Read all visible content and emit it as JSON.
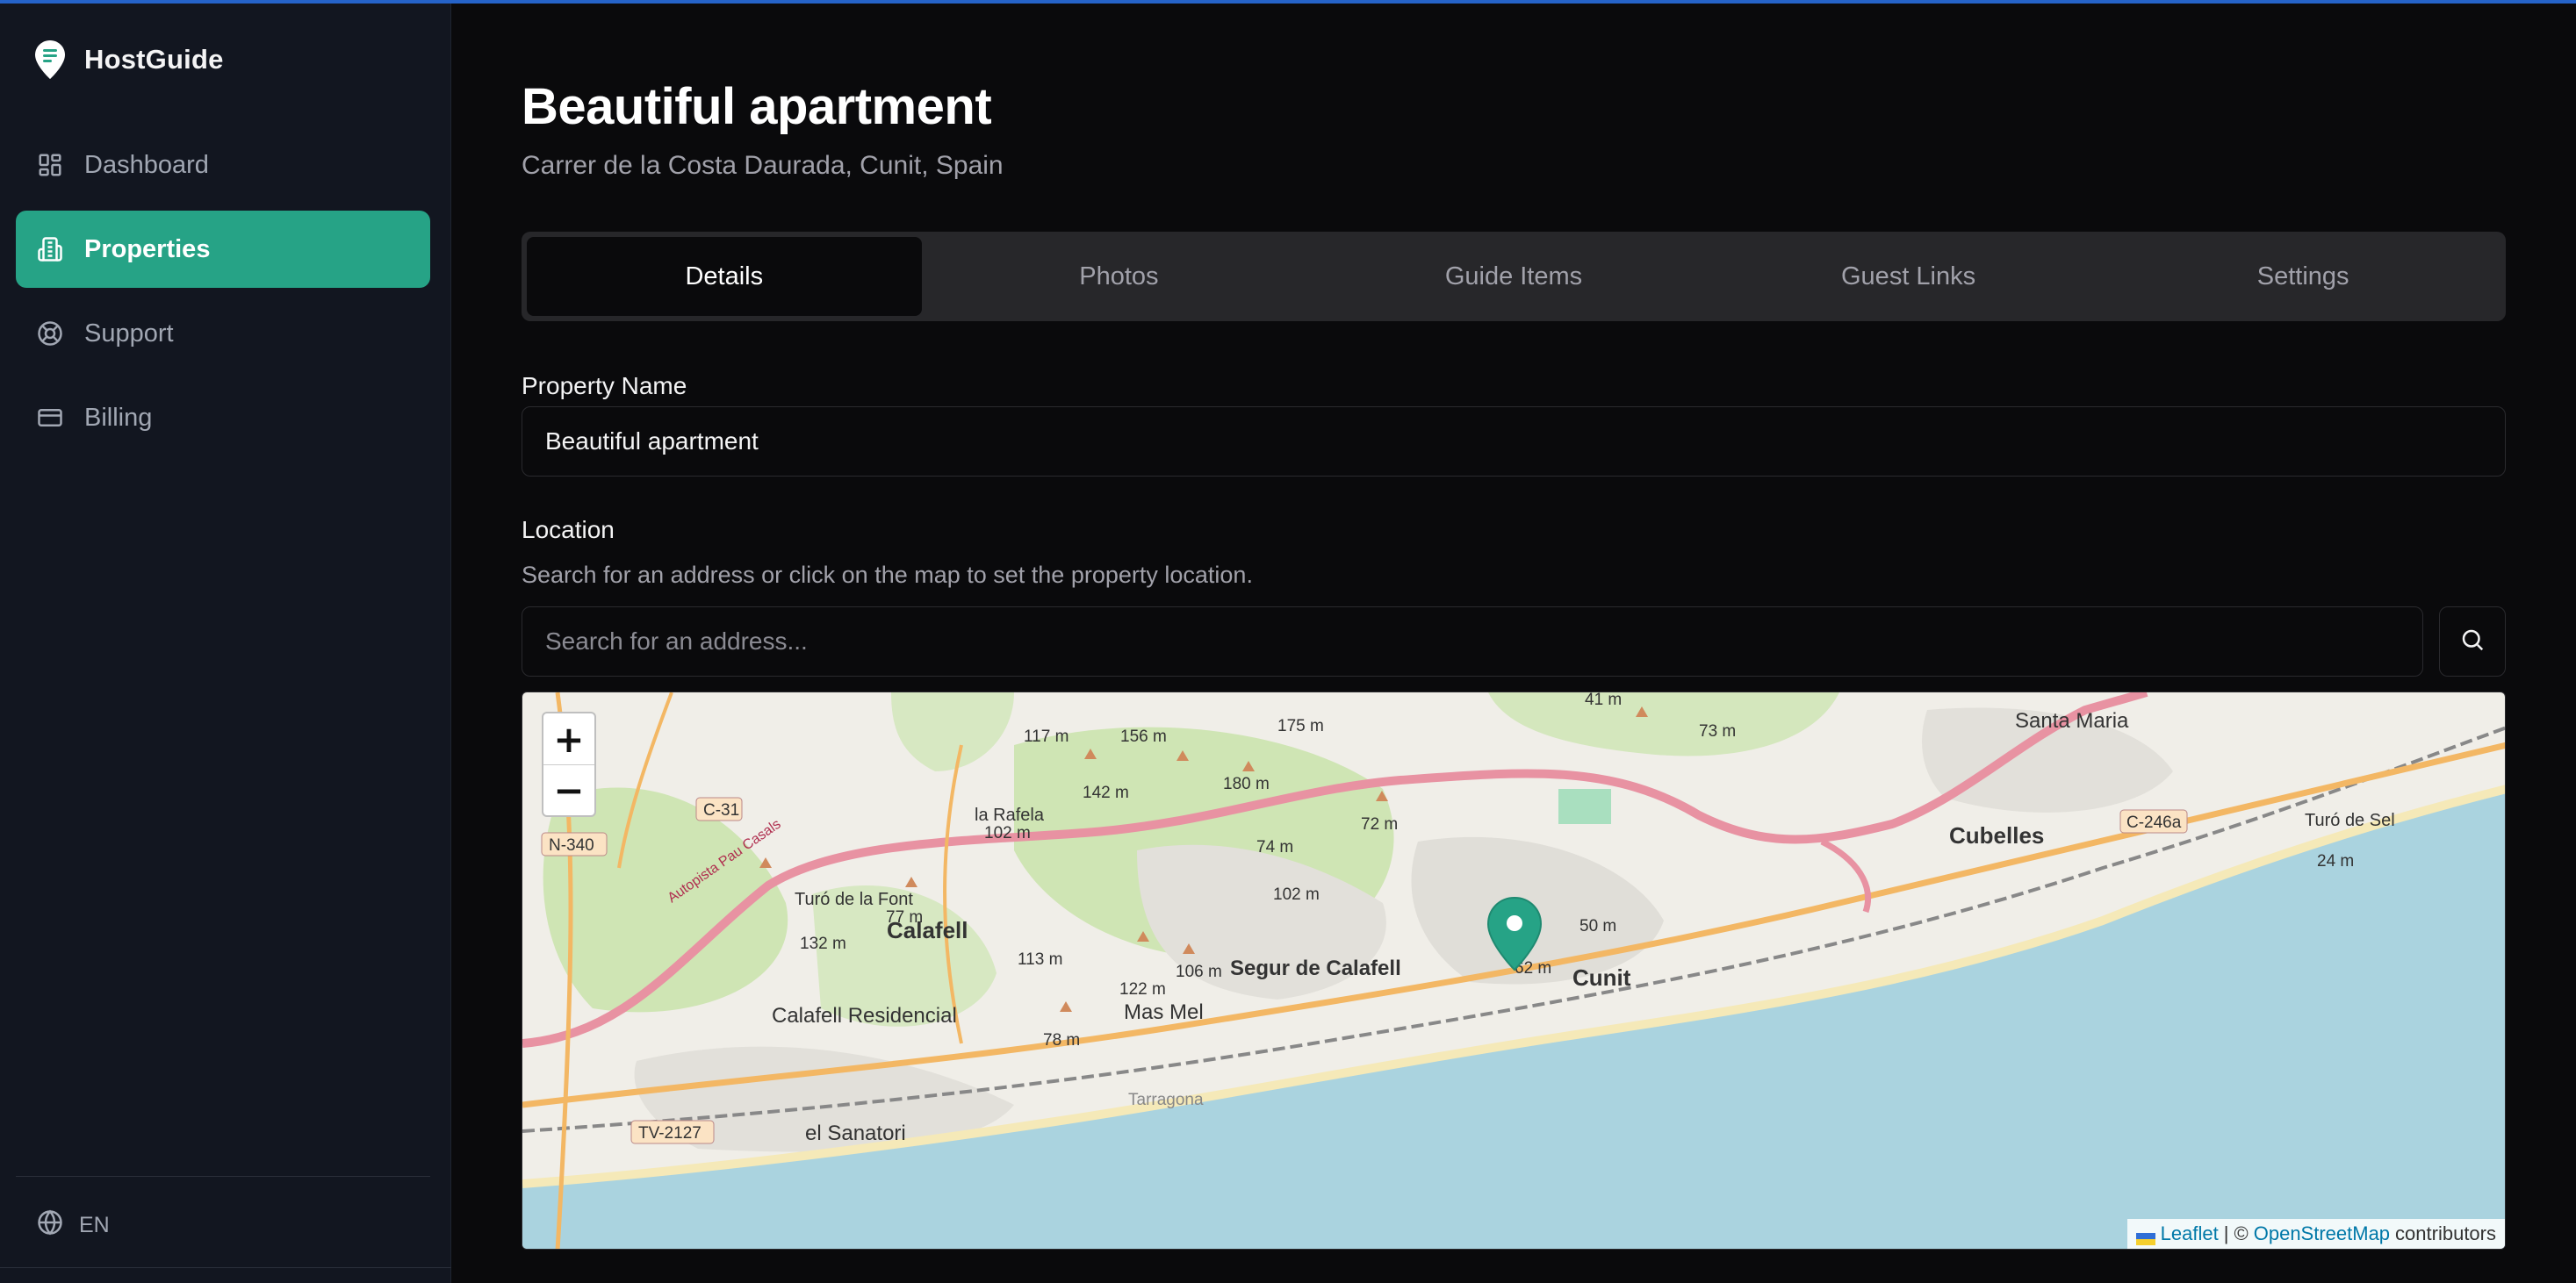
{
  "app": {
    "name": "HostGuide"
  },
  "sidebar": {
    "items": [
      {
        "label": "Dashboard",
        "icon": "dashboard-icon",
        "active": false
      },
      {
        "label": "Properties",
        "icon": "building-icon",
        "active": true
      },
      {
        "label": "Support",
        "icon": "lifebuoy-icon",
        "active": false
      },
      {
        "label": "Billing",
        "icon": "credit-card-icon",
        "active": false
      }
    ],
    "language": "EN"
  },
  "page": {
    "title": "Beautiful apartment",
    "subtitle": "Carrer de la Costa Daurada, Cunit, Spain"
  },
  "tabs": [
    {
      "label": "Details",
      "active": true
    },
    {
      "label": "Photos",
      "active": false
    },
    {
      "label": "Guide Items",
      "active": false
    },
    {
      "label": "Guest Links",
      "active": false
    },
    {
      "label": "Settings",
      "active": false
    }
  ],
  "form": {
    "property_name_label": "Property Name",
    "property_name_value": "Beautiful apartment",
    "location_label": "Location",
    "location_helper": "Search for an address or click on the map to set the property location.",
    "search_placeholder": "Search for an address..."
  },
  "map": {
    "zoom_in": "+",
    "zoom_out": "−",
    "attribution_leaflet": "Leaflet",
    "attribution_sep": "| ©",
    "attribution_osm": "OpenStreetMap",
    "attribution_suffix": "contributors",
    "labels": {
      "santa_maria": "Santa Maria",
      "cubelles": "Cubelles",
      "calafell": "Calafell",
      "segur": "Segur de Calafell",
      "cunit": "Cunit",
      "calafell_res": "Calafell Residencial",
      "mas_mel": "Mas Mel",
      "el_sanatori": "el Sanatori",
      "la_rafela": "la Rafela",
      "turo_font": "Turó de la Font",
      "turo_sel": "Turó de Sel",
      "tarragona": "Tarragona",
      "road_c31": "C-31",
      "road_n340": "N-340",
      "road_tv2127": "TV-2127",
      "road_c246a": "C-246a",
      "autopista": "Autopista Pau Casals",
      "m117": "117 m",
      "m156": "156 m",
      "m175": "175 m",
      "m142": "142 m",
      "m180": "180 m",
      "m102a": "102 m",
      "m74": "74 m",
      "m72": "72 m",
      "m102b": "102 m",
      "m132": "132 m",
      "m77": "77 m",
      "m113": "113 m",
      "m106": "106 m",
      "m122": "122 m",
      "m78": "78 m",
      "m50": "50 m",
      "m62": "62 m",
      "m41": "41 m",
      "m73": "73 m",
      "m24": "24 m"
    },
    "marker_color": "#26a386"
  },
  "colors": {
    "accent": "#26a386",
    "top_line": "#2563c9"
  }
}
